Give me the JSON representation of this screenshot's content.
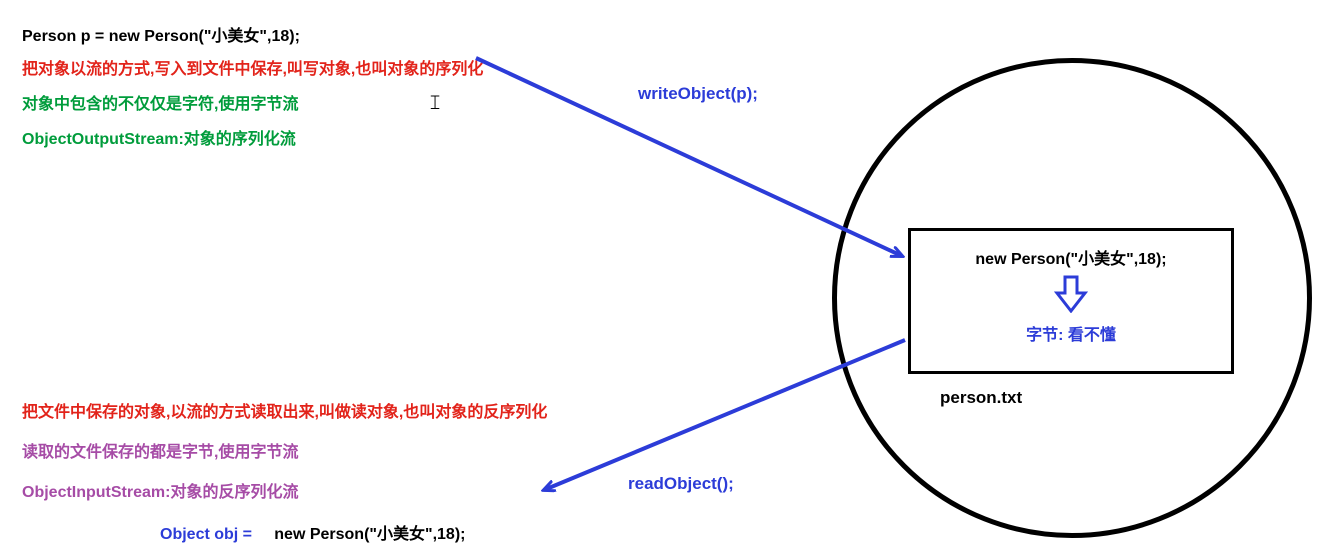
{
  "left": {
    "code_line": "Person p = new Person(\"小美女\",18);",
    "write_desc": "把对象以流的方式,写入到文件中保存,叫写对象,也叫对象的序列化",
    "write_note": "对象中包含的不仅仅是字符,使用字节流",
    "write_stream": "ObjectOutputStream:对象的序列化流",
    "read_desc": "把文件中保存的对象,以流的方式读取出来,叫做读对象,也叫对象的反序列化",
    "read_note": "读取的文件保存的都是字节,使用字节流",
    "read_stream": "ObjectInputStream:对象的反序列化流",
    "obj_lhs": "Object obj =",
    "obj_rhs": "new Person(\"小美女\",18);"
  },
  "arrows": {
    "write_label": "writeObject(p);",
    "read_label": "readObject();"
  },
  "file": {
    "content": "new Person(\"小美女\",18);",
    "bytes_label": "字节: 看不懂",
    "filename": "person.txt"
  },
  "glyphs": {
    "text_cursor": "𝙸"
  }
}
